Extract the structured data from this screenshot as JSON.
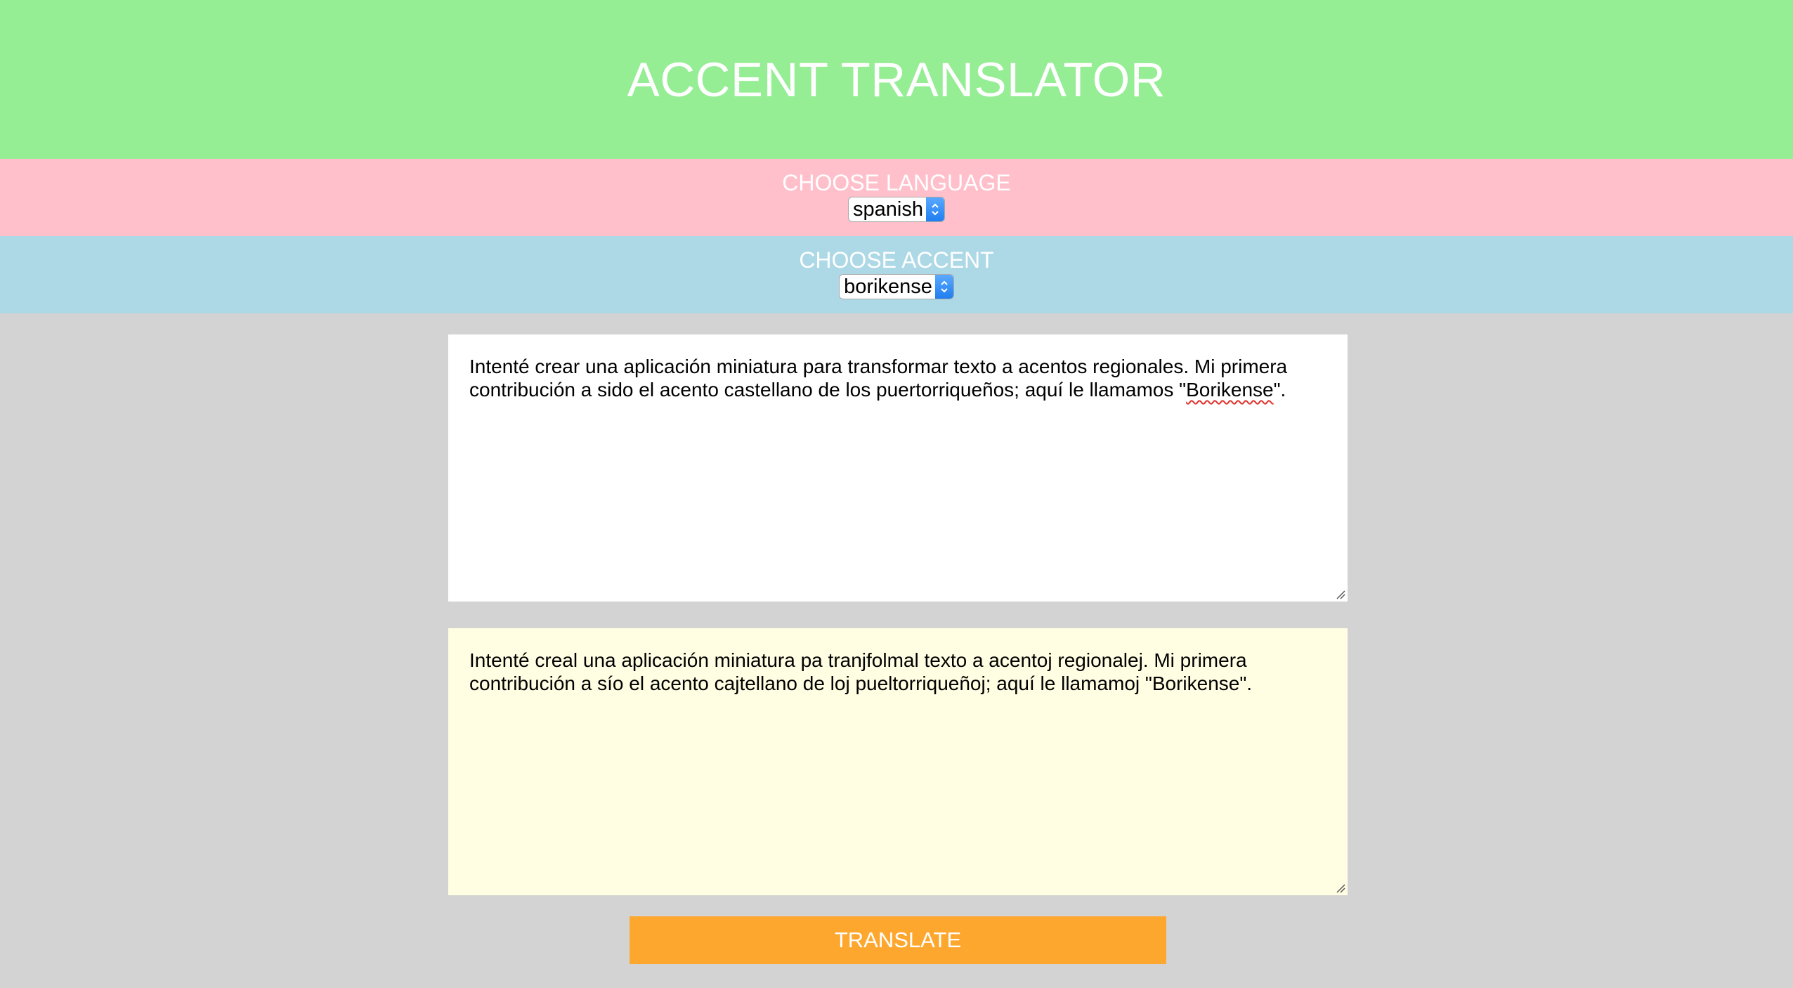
{
  "app": {
    "title": "ACCENT TRANSLATOR"
  },
  "language": {
    "label": "CHOOSE LANGUAGE",
    "selected": "spanish"
  },
  "accent": {
    "label": "CHOOSE ACCENT",
    "selected": "borikense"
  },
  "input": {
    "text_before": "Intenté crear una aplicación miniatura para transformar texto a acentos regionales.  Mi primera contribución a sido el acento castellano de los puertorriqueños; aquí le llamamos \"",
    "text_misspelled": "Borikense",
    "text_after": "\"."
  },
  "output": {
    "text": "Intenté creal una aplicación miniatura pa tranjfolmal texto a acentoj regionalej.  Mi primera contribución a sío el acento cajtellano de loj pueltorriqueñoj; aquí le llamamoj \"Borikense\"."
  },
  "actions": {
    "translate_label": "TRANSLATE"
  },
  "colors": {
    "header": "#95ed94",
    "language_band": "#ffc0cb",
    "accent_band": "#add8e6",
    "background": "#d3d3d3",
    "output_bg": "#fffde2",
    "button": "#fea72e"
  },
  "icons": {
    "select_arrows": "chevron-up-down-icon",
    "resize_grip": "resize-grip-icon"
  }
}
